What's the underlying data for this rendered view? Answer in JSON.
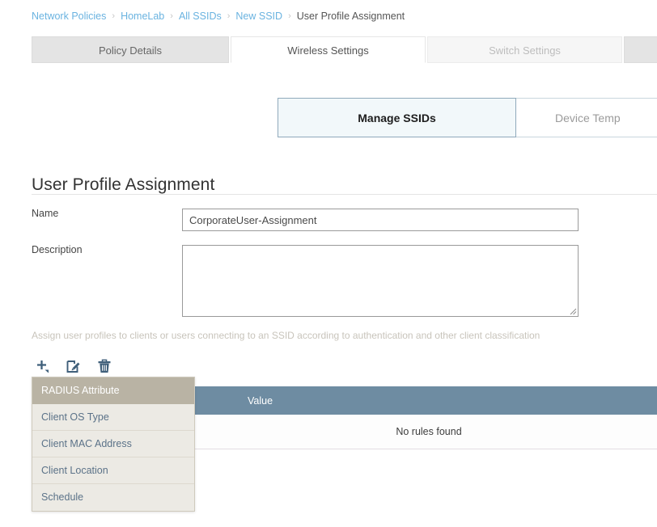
{
  "breadcrumb": {
    "items": [
      {
        "label": "Network Policies",
        "type": "link"
      },
      {
        "label": "HomeLab",
        "type": "link"
      },
      {
        "label": "All SSIDs",
        "type": "link"
      },
      {
        "label": "New SSID",
        "type": "link"
      },
      {
        "label": "User Profile Assignment",
        "type": "current"
      }
    ],
    "separator": "›"
  },
  "tabs": [
    {
      "label": "Policy Details",
      "state": "inactive"
    },
    {
      "label": "Wireless Settings",
      "state": "active"
    },
    {
      "label": "Switch Settings",
      "state": "disabled"
    },
    {
      "label": "",
      "state": "inactive"
    }
  ],
  "subtabs": [
    {
      "label": "Manage SSIDs",
      "state": "active"
    },
    {
      "label": "Device Temp",
      "state": "inactive"
    }
  ],
  "page": {
    "title": "User Profile Assignment",
    "helper_text": "Assign user profiles to clients or users connecting to an SSID according to authentication and other client classification"
  },
  "form": {
    "name": {
      "label": "Name",
      "value": "CorporateUser-Assignment",
      "placeholder": ""
    },
    "description": {
      "label": "Description",
      "value": "",
      "placeholder": ""
    }
  },
  "toolbar": {
    "add": "add-icon",
    "edit": "edit-icon",
    "delete": "delete-icon"
  },
  "table": {
    "columns": [
      "Value"
    ],
    "empty_message": "No rules found",
    "rows": []
  },
  "dropdown": {
    "items": [
      {
        "label": "RADIUS Attribute",
        "selected": true
      },
      {
        "label": "Client OS Type",
        "selected": false
      },
      {
        "label": "Client MAC Address",
        "selected": false
      },
      {
        "label": "Client Location",
        "selected": false
      },
      {
        "label": "Schedule",
        "selected": false
      }
    ]
  },
  "colors": {
    "link": "#6ab3e0",
    "table_header": "#6e8ca2",
    "dropdown_selected": "#b9b3a4",
    "subtab_active_bg": "#f2f8fa",
    "icon": "#3f5f7a"
  }
}
